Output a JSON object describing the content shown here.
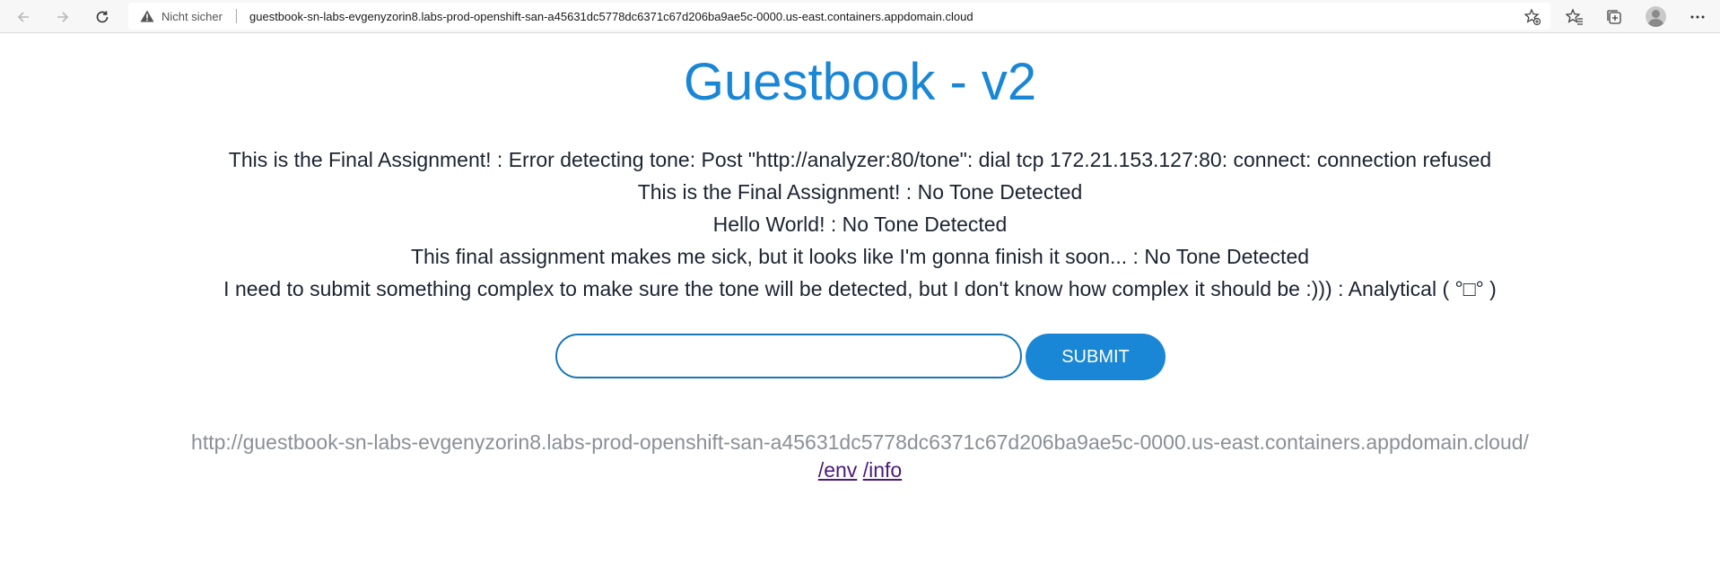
{
  "browser": {
    "security_label": "Nicht sicher",
    "url": "guestbook-sn-labs-evgenyzorin8.labs-prod-openshift-san-a45631dc5778dc6371c67d206ba9ae5c-0000.us-east.containers.appdomain.cloud",
    "icons": {
      "back": "back-arrow-icon",
      "forward": "forward-arrow-icon",
      "reload": "reload-icon",
      "warning": "warning-icon",
      "favorite": "add-favorite-icon",
      "favorites": "favorites-icon",
      "collections": "collections-icon",
      "profile": "profile-avatar",
      "menu": "more-menu-icon"
    }
  },
  "page": {
    "title": "Guestbook - v2",
    "entries": [
      "This is the Final Assignment! : Error detecting tone: Post \"http://analyzer:80/tone\": dial tcp 172.21.153.127:80: connect: connection refused",
      "This is the Final Assignment! : No Tone Detected",
      "Hello World! : No Tone Detected",
      "This final assignment makes me sick, but it looks like I'm gonna finish it soon... : No Tone Detected",
      "I need to submit something complex to make sure the tone will be detected, but I don't know how complex it should be :))) : Analytical ( °□° )"
    ],
    "form": {
      "input_value": "",
      "submit_label": "SUBMIT"
    },
    "server_url": "http://guestbook-sn-labs-evgenyzorin8.labs-prod-openshift-san-a45631dc5778dc6371c67d206ba9ae5c-0000.us-east.containers.appdomain.cloud/",
    "links": {
      "env": "/env",
      "info": "/info"
    }
  },
  "colors": {
    "title": "#1a86d6",
    "button": "#1a86d6",
    "input_border": "#1877b8",
    "server_url": "#8b8f96",
    "link": "#4a1b7a"
  }
}
